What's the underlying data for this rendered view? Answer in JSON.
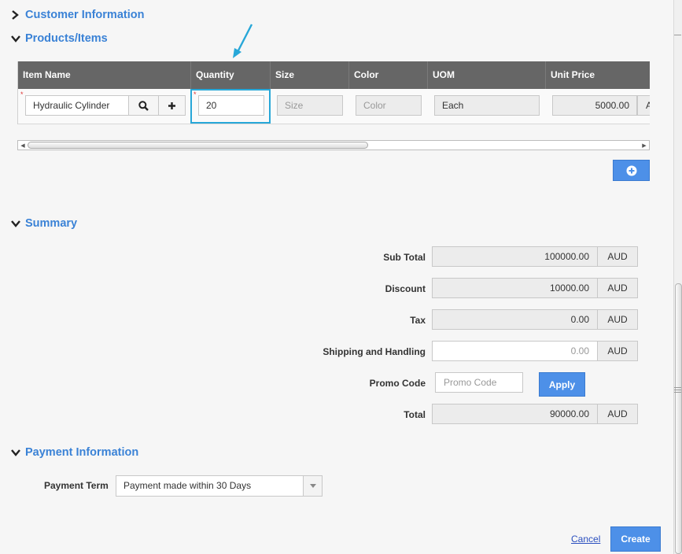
{
  "sections": {
    "customer_info": "Customer Information",
    "products_items": "Products/Items",
    "summary": "Summary",
    "payment_info": "Payment Information"
  },
  "grid": {
    "columns": [
      "Item Name",
      "Quantity",
      "Size",
      "Color",
      "UOM",
      "Unit Price"
    ],
    "row": {
      "item_name": "Hydraulic Cylinder",
      "quantity": "20",
      "size_placeholder": "Size",
      "color_placeholder": "Color",
      "uom": "Each",
      "unit_price": "5000.00",
      "currency_partial": "A"
    }
  },
  "summary": {
    "subtotal_label": "Sub Total",
    "subtotal_value": "100000.00",
    "discount_label": "Discount",
    "discount_value": "10000.00",
    "tax_label": "Tax",
    "tax_value": "0.00",
    "shipping_label": "Shipping and Handling",
    "shipping_value": "0.00",
    "promo_label": "Promo Code",
    "promo_placeholder": "Promo Code",
    "apply_label": "Apply",
    "total_label": "Total",
    "total_value": "90000.00",
    "currency": "AUD"
  },
  "payment": {
    "term_label": "Payment Term",
    "term_value": "Payment made within 30 Days"
  },
  "footer": {
    "cancel_label": "Cancel",
    "create_label": "Create"
  },
  "colors": {
    "accent": "#3a82d6",
    "button": "#4d90e8",
    "header_bg": "#666666",
    "highlight": "#27a7d8"
  }
}
